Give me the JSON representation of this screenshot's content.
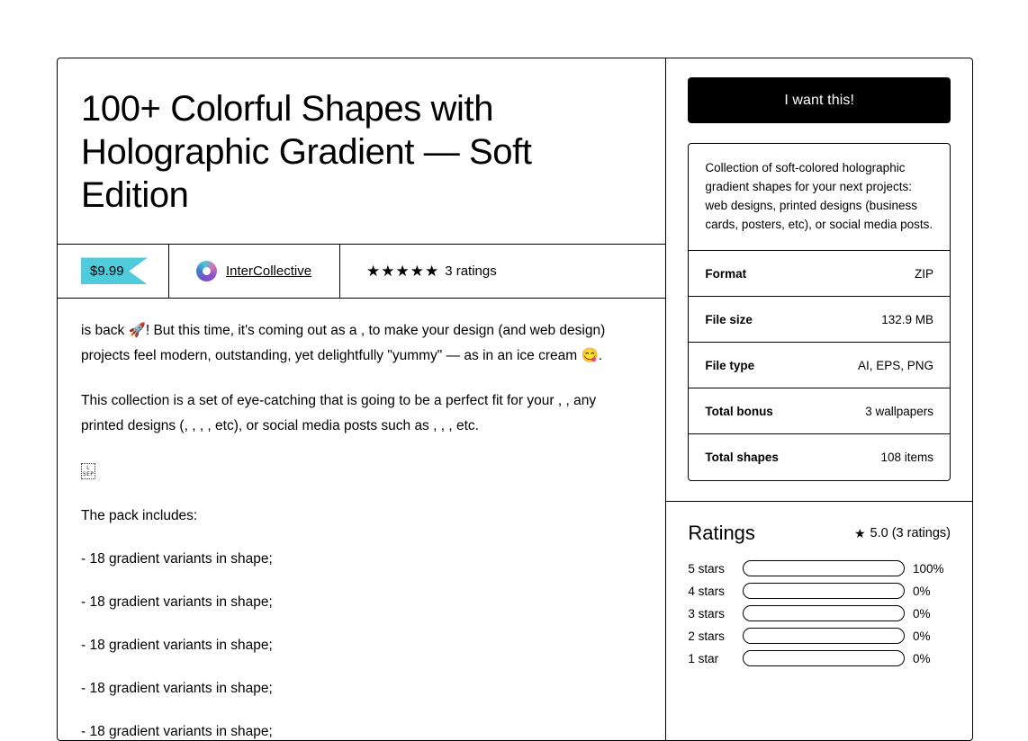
{
  "product": {
    "title": "100+ Colorful Shapes with Holographic Gradient — Soft Edition",
    "price": "$9.99",
    "seller": "InterCollective",
    "stars_glyphs": "★★★★★",
    "ratings_count_label": "3 ratings"
  },
  "description": {
    "paragraph_1": " is back 🚀! But this time, it's coming out as a , to make your design (and web design) projects feel modern, outstanding, yet delightfully \"yummy\" — as in an ice cream 😋.",
    "paragraph_2": "This collection is a set of eye-catching that is going to be a perfect fit for your , , any printed designs (, , , , etc), or social media posts such as , , , etc.",
    "tofu_glyph_line1": "L",
    "tofu_glyph_line2": "SEP",
    "pack_includes_heading": "The pack includes:",
    "pack_items": [
      "- 18 gradient variants in  shape;",
      "- 18 gradient variants in  shape;",
      "- 18 gradient variants in  shape;",
      "- 18 gradient variants in  shape;",
      "- 18 gradient variants in  shape;"
    ]
  },
  "sidebar": {
    "buy_label": "I want this!",
    "summary": "Collection of soft-colored holographic gradient shapes for your next projects: web designs, printed designs (business cards, posters, etc), or social media posts.",
    "details": [
      {
        "label": "Format",
        "value": "ZIP"
      },
      {
        "label": "File size",
        "value": "132.9 MB"
      },
      {
        "label": "File type",
        "value": "AI, EPS, PNG"
      },
      {
        "label": "Total bonus",
        "value": "3 wallpapers"
      },
      {
        "label": "Total shapes",
        "value": "108 items"
      }
    ]
  },
  "ratings": {
    "title": "Ratings",
    "star_glyph": "★",
    "average": "5.0 (3 ratings)",
    "breakdown": [
      {
        "label": "5 stars",
        "pct": "100%",
        "value": 100
      },
      {
        "label": "4 stars",
        "pct": "0%",
        "value": 0
      },
      {
        "label": "3 stars",
        "pct": "0%",
        "value": 0
      },
      {
        "label": "2 stars",
        "pct": "0%",
        "value": 0
      },
      {
        "label": "1 star",
        "pct": "0%",
        "value": 0
      }
    ]
  },
  "colors": {
    "accent_cyan": "#4FCBDB",
    "button_black": "#000000",
    "page_background": "#FFFFFF"
  }
}
